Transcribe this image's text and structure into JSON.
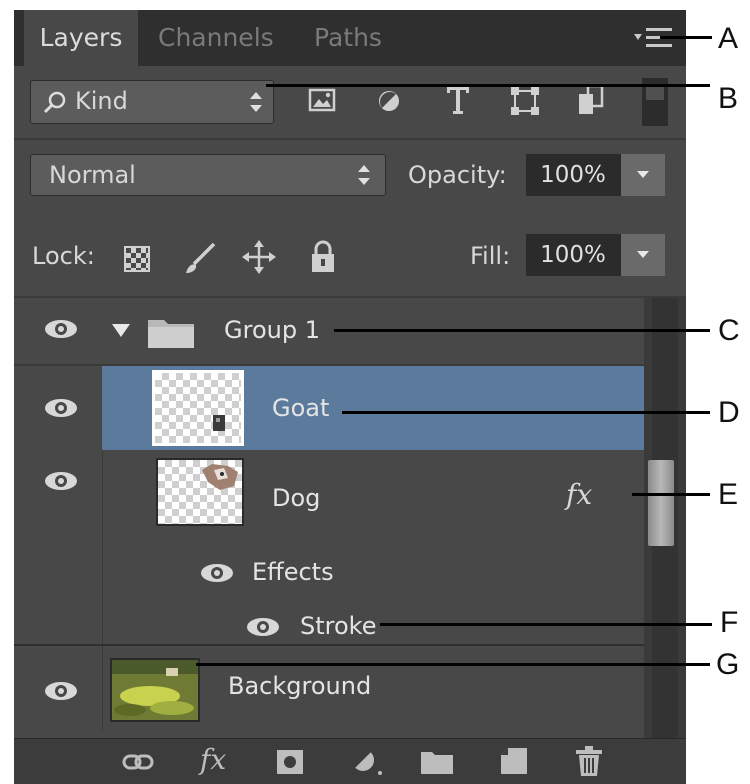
{
  "tabs": [
    {
      "label": "Layers",
      "active": true
    },
    {
      "label": "Channels",
      "active": false
    },
    {
      "label": "Paths",
      "active": false
    }
  ],
  "filter": {
    "kind_label": "Kind"
  },
  "blend": {
    "mode": "Normal",
    "opacity_label": "Opacity:",
    "opacity_value": "100%"
  },
  "lock": {
    "label": "Lock:",
    "fill_label": "Fill:",
    "fill_value": "100%"
  },
  "layers": {
    "group": "Group 1",
    "goat": "Goat",
    "dog": "Dog",
    "fx": "fx",
    "effects": "Effects",
    "stroke": "Stroke",
    "background": "Background"
  },
  "footer": {
    "fx": "fx"
  },
  "callouts": [
    "A",
    "B",
    "C",
    "D",
    "E",
    "F",
    "G"
  ],
  "colors": {
    "panel": "#484848",
    "selected_row": "#5b7a9c",
    "tabbar": "#2f2f2f"
  }
}
